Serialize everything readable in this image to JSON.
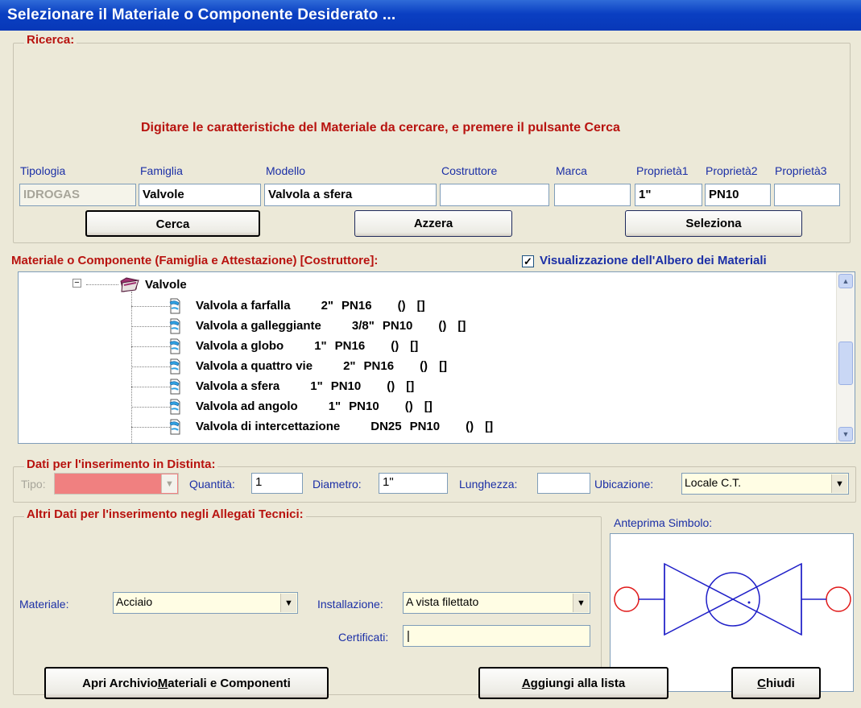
{
  "window": {
    "title": "Selezionare il Materiale o Componente Desiderato ..."
  },
  "ricerca": {
    "legend": "Ricerca:",
    "instruction": "Digitare le caratteristiche del Materiale da cercare, e premere il pulsante Cerca",
    "labels": {
      "tipologia": "Tipologia",
      "famiglia": "Famiglia",
      "modello": "Modello",
      "costruttore": "Costruttore",
      "marca": "Marca",
      "proprieta1": "Proprietà1",
      "proprieta2": "Proprietà2",
      "proprieta3": "Proprietà3"
    },
    "values": {
      "tipologia": "IDROGAS",
      "famiglia": "Valvole",
      "modello": "Valvola a sfera",
      "costruttore": "",
      "marca": "",
      "proprieta1": "1\"",
      "proprieta2": "PN10",
      "proprieta3": ""
    },
    "buttons": {
      "cerca": "Cerca",
      "azzera": "Azzera",
      "seleziona": "Seleziona"
    }
  },
  "tree": {
    "header": "Materiale o Componente  (Famiglia e Attestazione)  [Costruttore]:",
    "checkbox_label": "Visualizzazione dell'Albero dei Materiali",
    "checkbox_checked": true,
    "expander": "−",
    "folder_label": "Valvole",
    "items": [
      {
        "name": "Valvola a farfalla",
        "size": "2\"",
        "pn": "PN16",
        "a": "()",
        "b": "[]"
      },
      {
        "name": "Valvola a galleggiante",
        "size": "3/8\"",
        "pn": "PN10",
        "a": "()",
        "b": "[]"
      },
      {
        "name": "Valvola a globo",
        "size": "1\"",
        "pn": "PN16",
        "a": "()",
        "b": "[]"
      },
      {
        "name": "Valvola a quattro vie",
        "size": "2\"",
        "pn": "PN16",
        "a": "()",
        "b": "[]"
      },
      {
        "name": "Valvola a sfera",
        "size": "1\"",
        "pn": "PN10",
        "a": "()",
        "b": "[]"
      },
      {
        "name": "Valvola ad angolo",
        "size": "1\"",
        "pn": "PN10",
        "a": "()",
        "b": "[]"
      },
      {
        "name": "Valvola di intercettazione",
        "size": "DN25",
        "pn": "PN10",
        "a": "()",
        "b": "[]"
      }
    ]
  },
  "distinta": {
    "legend": "Dati per l'inserimento in Distinta:",
    "tipo_label": "Tipo:",
    "tipo_value": "",
    "quantita_label": "Quantità:",
    "quantita_value": "1",
    "diametro_label": "Diametro:",
    "diametro_value": "1\"",
    "lunghezza_label": "Lunghezza:",
    "lunghezza_value": "",
    "ubicazione_label": "Ubicazione:",
    "ubicazione_value": "Locale C.T."
  },
  "allegati": {
    "legend": "Altri Dati per l'inserimento negli Allegati Tecnici:",
    "materiale_label": "Materiale:",
    "materiale_value": "Acciaio",
    "installazione_label": "Installazione:",
    "installazione_value": "A vista filettato",
    "certificati_label": "Certificati:",
    "certificati_value": "|"
  },
  "anteprima": {
    "label": "Anteprima Simbolo:"
  },
  "footer": {
    "apri_pre": "Apri Archivio ",
    "apri_u": "M",
    "apri_post": "ateriali e Componenti",
    "aggiungi_pre": "",
    "aggiungi_u": "A",
    "aggiungi_post": "ggiungi alla lista",
    "chiudi_pre": "",
    "chiudi_u": "C",
    "chiudi_post": "hiudi"
  },
  "colors": {
    "title_bar": "#0A3FC2",
    "legend_red": "#B8130F",
    "label_blue": "#1B2FA6",
    "tipo_pink": "#F08080",
    "symbol_blue": "#2020C8",
    "symbol_red": "#E01818"
  }
}
